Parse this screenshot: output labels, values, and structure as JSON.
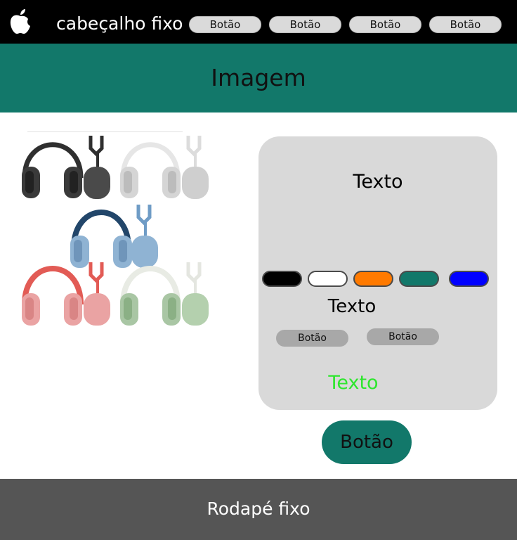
{
  "header": {
    "logo_icon": "apple-logo-icon",
    "title": "cabeçalho fixo",
    "nav_buttons": [
      "Botão",
      "Botão",
      "Botão",
      "Botão"
    ]
  },
  "banner": {
    "text": "Imagem"
  },
  "product_image": {
    "icon": "headphones-product-image"
  },
  "card": {
    "title": "Texto",
    "swatches": [
      {
        "name": "black",
        "color": "#000000"
      },
      {
        "name": "white",
        "color": "#ffffff"
      },
      {
        "name": "orange",
        "color": "#ff7a00"
      },
      {
        "name": "teal",
        "color": "#12786a"
      },
      {
        "name": "blue",
        "color": "#0000ff"
      }
    ],
    "subtitle": "Texto",
    "buttons": [
      "Botão",
      "Botão"
    ],
    "note": "Texto",
    "note_color": "#2ee62e"
  },
  "cta": {
    "label": "Botão"
  },
  "footer": {
    "text": "Rodapé fixo"
  },
  "colors": {
    "header_bg": "#000000",
    "accent": "#12786a",
    "card_bg": "#d9d9d9",
    "footer_bg": "#555555"
  }
}
